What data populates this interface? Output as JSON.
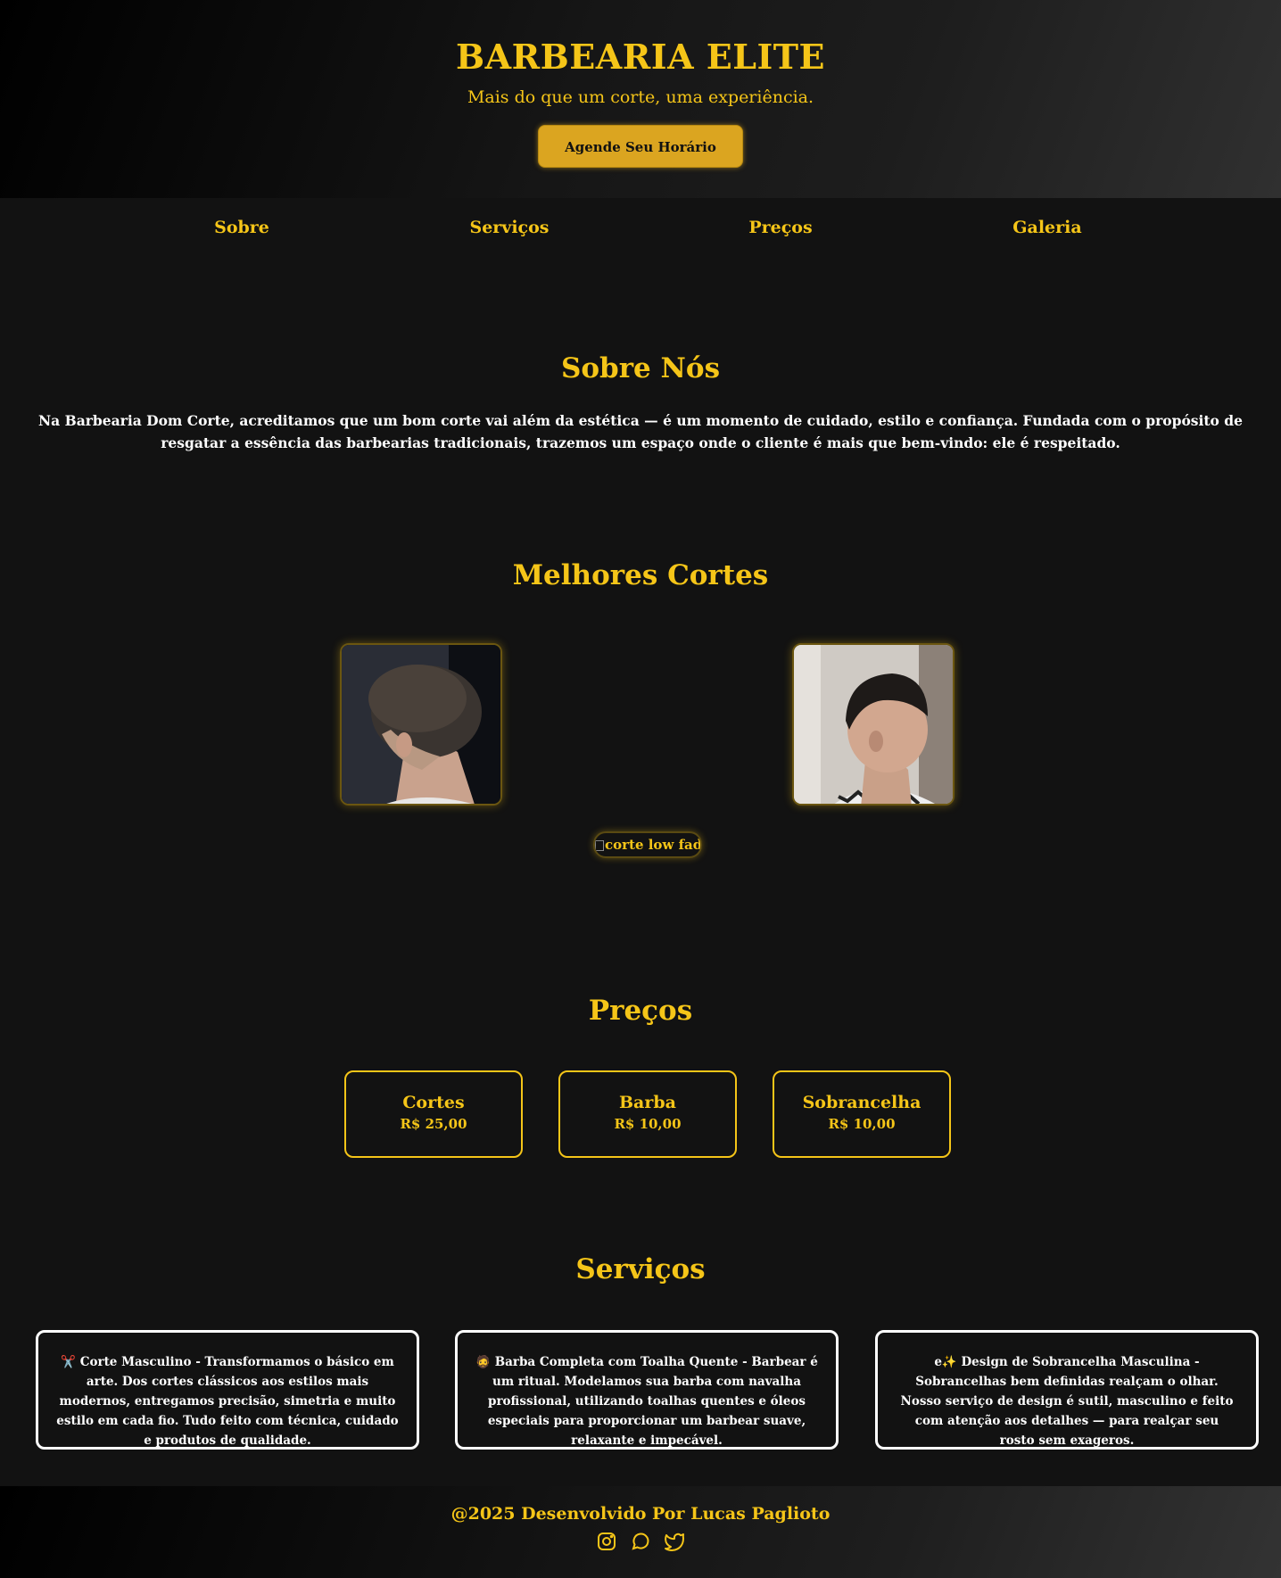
{
  "header": {
    "title": "BARBEARIA ELITE",
    "tagline": "Mais do que um corte, uma experiência.",
    "cta_label": "Agende Seu Horário"
  },
  "nav": {
    "items": [
      "Sobre",
      "Serviços",
      "Preços",
      "Galeria"
    ]
  },
  "about": {
    "title": "Sobre Nós",
    "text": "Na Barbearia Dom Corte, acreditamos que um bom corte vai além da estética — é um momento de cuidado, estilo e confiança. Fundada com o propósito de resgatar a essência das barbearias tradicionais, trazemos um espaço onde o cliente é mais que bem-vindo: ele é respeitado."
  },
  "gallery": {
    "title": "Melhores Cortes",
    "broken_image_alt": "corte low fade"
  },
  "prices": {
    "title": "Preços",
    "items": [
      {
        "name": "Cortes",
        "value": "R$ 25,00"
      },
      {
        "name": "Barba",
        "value": "R$ 10,00"
      },
      {
        "name": "Sobrancelha",
        "value": "R$ 10,00"
      }
    ]
  },
  "services": {
    "title": "Serviços",
    "items": [
      {
        "icon": "scissors-icon",
        "emoji": "✂️",
        "text": "Corte Masculino - Transformamos o básico em arte. Dos cortes clássicos aos estilos mais modernos, entregamos precisão, simetria e muito estilo em cada fio. Tudo feito com técnica, cuidado e produtos de qualidade."
      },
      {
        "icon": "beard-icon",
        "emoji": "🧔",
        "text": "Barba Completa com Toalha Quente - Barbear é um ritual. Modelamos sua barba com navalha profissional, utilizando toalhas quentes e óleos especiais para proporcionar um barbear suave, relaxante e impecável."
      },
      {
        "icon": "sparkles-icon",
        "emoji": "e✨",
        "text": "Design de Sobrancelha Masculina - Sobrancelhas bem definidas realçam o olhar. Nosso serviço de design é sutil, masculino e feito com atenção aos detalhes — para realçar seu rosto sem exageros."
      }
    ]
  },
  "footer": {
    "credit": "@2025 Desenvolvido Por Lucas Paglioto",
    "social_icons": [
      "instagram-icon",
      "whatsapp-icon",
      "twitter-icon"
    ]
  },
  "colors": {
    "accent": "#f5c518",
    "button": "#dba520",
    "background": "#121212"
  }
}
